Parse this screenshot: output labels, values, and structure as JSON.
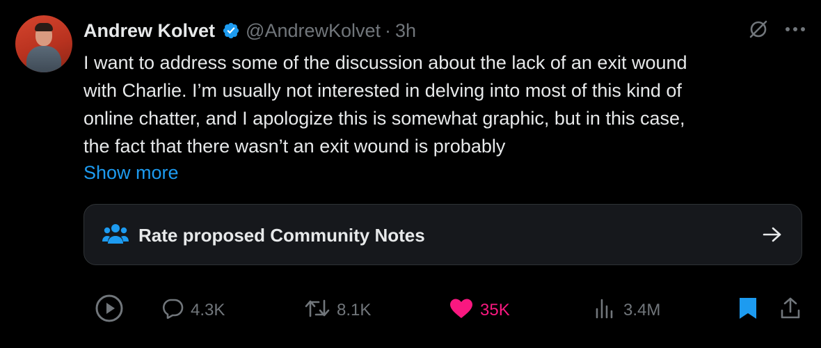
{
  "author": {
    "name": "Andrew Kolvet",
    "handle": "@AndrewKolvet",
    "separator": "·",
    "time": "3h",
    "verified_color": "#1d9bf0"
  },
  "tweet": {
    "text": "I want to address some of the discussion about the lack of an exit wound\nwith Charlie. I’m usually not interested in delving into most of this kind of\nonline chatter, and I apologize this is somewhat graphic, but in this case,\nthe fact that there wasn’t an exit wound is probably",
    "show_more": "Show more"
  },
  "community_notes": {
    "label": "Rate proposed Community Notes",
    "icon": "people-icon"
  },
  "actions": {
    "replies": "4.3K",
    "reposts": "8.1K",
    "likes": "35K",
    "views": "3.4M",
    "like_color": "#f91880",
    "bookmark_color": "#1d9bf0"
  },
  "icons": {
    "top": [
      "grok-icon",
      "more-icon"
    ],
    "bottom": [
      "play-icon",
      "reply-icon",
      "repost-icon",
      "like-icon",
      "views-icon",
      "bookmark-icon",
      "share-icon"
    ]
  }
}
